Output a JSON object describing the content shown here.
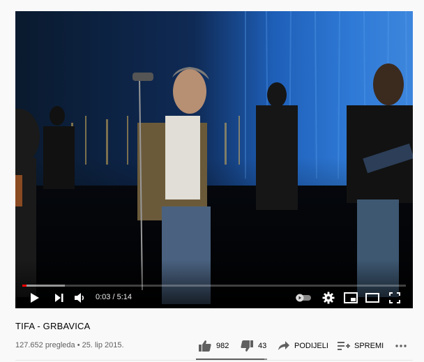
{
  "video": {
    "title": "TIFA - GRBAVICA",
    "current_time": "0:03",
    "duration": "5:14",
    "time_display": "0:03 / 5:14",
    "progress_fraction": 0.01,
    "buffered_fraction": 0.11
  },
  "player_controls": {
    "play_icon": "play-icon",
    "next_icon": "next-icon",
    "volume_icon": "volume-icon",
    "autoplay_icon": "autoplay-toggle-icon",
    "settings_icon": "gear-icon",
    "miniplayer_icon": "miniplayer-icon",
    "theater_icon": "theater-mode-icon",
    "fullscreen_icon": "fullscreen-icon"
  },
  "meta": {
    "views_date": "127.652 pregleda • 25. lip 2015.",
    "likes": "982",
    "dislikes": "43",
    "share_label": "PODIJELI",
    "save_label": "SPREMI",
    "like_fraction": 0.958
  },
  "colors": {
    "progress_played": "#ff0000",
    "background": "#f9f9f9",
    "stage_curtain": "#1e5fb8"
  }
}
